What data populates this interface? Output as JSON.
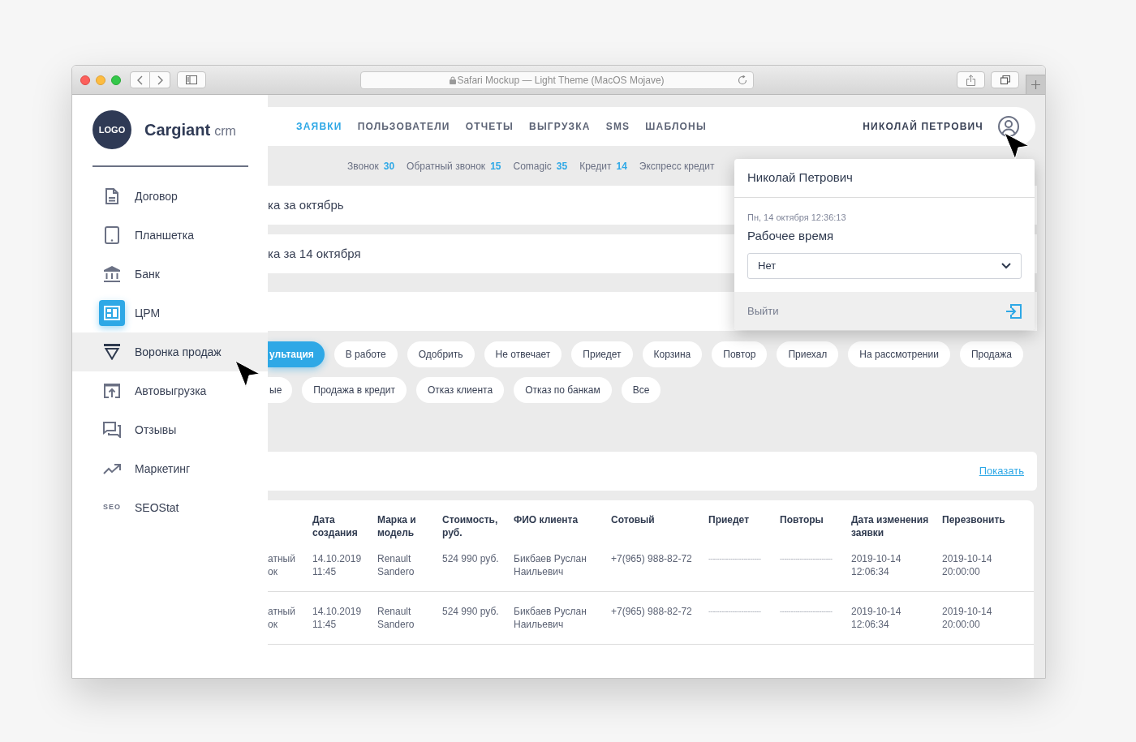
{
  "window": {
    "title": "Safari Mockup — Light Theme (MacOS Mojave)"
  },
  "sidebar": {
    "logo": "LOGO",
    "brand": "Cargiant",
    "brand_suffix": "crm",
    "items": [
      {
        "label": "Договор",
        "selected": false,
        "highlighted": false
      },
      {
        "label": "Планшетка",
        "selected": false,
        "highlighted": false
      },
      {
        "label": "Банк",
        "selected": false,
        "highlighted": false
      },
      {
        "label": "ЦРМ",
        "selected": true,
        "highlighted": false
      },
      {
        "label": "Воронка продаж",
        "selected": false,
        "highlighted": true
      },
      {
        "label": "Автовыгрузка",
        "selected": false,
        "highlighted": false
      },
      {
        "label": "Отзывы",
        "selected": false,
        "highlighted": false
      },
      {
        "label": "Маркетинг",
        "selected": false,
        "highlighted": false
      },
      {
        "label": "SEOStat",
        "badge": "SEO",
        "selected": false,
        "highlighted": false
      }
    ]
  },
  "nav": {
    "items": [
      {
        "label": "ЗАЯВКИ",
        "selected": true
      },
      {
        "label": "ПОЛЬЗОВАТЕЛИ",
        "selected": false
      },
      {
        "label": "ОТЧЕТЫ",
        "selected": false
      },
      {
        "label": "ВЫГРУЗКА",
        "selected": false
      },
      {
        "label": "SMS",
        "selected": false
      },
      {
        "label": "ШАБЛОНЫ",
        "selected": false
      }
    ],
    "user": "НИКОЛАЙ ПЕТРОВИЧ"
  },
  "counters": [
    {
      "label": "Звонок",
      "count": "30"
    },
    {
      "label": "Обратный звонок",
      "count": "15"
    },
    {
      "label": "Comagic",
      "count": "35"
    },
    {
      "label": "Кредит",
      "count": "14"
    },
    {
      "label": "Экспресс кредит"
    }
  ],
  "report_rows": [
    {
      "title": "ка за октябрь"
    },
    {
      "title": "ка за 14 октября"
    }
  ],
  "user_menu": {
    "name": "Николай Петрович",
    "datetime": "Пн, 14 октября 12:36:13",
    "field_label": "Рабочее время",
    "select": {
      "value": "Нет"
    },
    "logout": "Выйти"
  },
  "filter_rows": [
    {
      "chips": [
        {
          "label": "ультация",
          "selected": true
        },
        {
          "label": "В работе",
          "selected": false
        },
        {
          "label": "Одобрить",
          "selected": false
        },
        {
          "label": "Не отвечает",
          "selected": false
        },
        {
          "label": "Приедет",
          "selected": false
        },
        {
          "label": "Корзина",
          "selected": false
        },
        {
          "label": "Повтор",
          "selected": false
        },
        {
          "label": "Приехал",
          "selected": false
        },
        {
          "label": "На рассмотрении",
          "selected": false
        },
        {
          "label": "Продажа",
          "selected": false
        }
      ]
    },
    {
      "chips": [
        {
          "label": "ые",
          "selected": false
        },
        {
          "label": "Продажа в кредит",
          "selected": false
        },
        {
          "label": "Отказ клиента",
          "selected": false
        },
        {
          "label": "Отказ по банкам",
          "selected": false
        },
        {
          "label": "Все",
          "selected": false
        }
      ]
    }
  ],
  "show_panel": {
    "link": "Показать"
  },
  "table": {
    "columns": [
      {
        "label": "Дата создания",
        "kind": "text"
      },
      {
        "label": "Марка и модель",
        "kind": "text"
      },
      {
        "label": "Стоимость, руб.",
        "kind": "text"
      },
      {
        "label": "ФИО клиента",
        "kind": "text"
      },
      {
        "label": "Сотовый",
        "kind": "text"
      },
      {
        "label": "Приедет",
        "kind": "placeholder"
      },
      {
        "label": "Повторы",
        "kind": "placeholder"
      },
      {
        "label": "Дата изменения заявки",
        "kind": "text"
      },
      {
        "label": "Перезвонить",
        "kind": "text"
      }
    ],
    "rows": [
      {
        "partial_cell": "атный\nок",
        "cells": [
          "14.10.2019 11:45",
          "Renault Sandero",
          "524 990 руб.",
          "Бикбаев Руслан Наильевич",
          "+7(965) 988-82-72",
          "------------------------",
          "------------------------",
          "2019-10-14 12:06:34",
          "2019-10-14 20:00:00"
        ]
      },
      {
        "partial_cell": "атный\nок",
        "cells": [
          "14.10.2019 11:45",
          "Renault Sandero",
          "524 990 руб.",
          "Бикбаев Руслан Наильевич",
          "+7(965) 988-82-72",
          "------------------------",
          "------------------------",
          "2019-10-14 12:06:34",
          "2019-10-14 20:00:00"
        ]
      }
    ]
  }
}
